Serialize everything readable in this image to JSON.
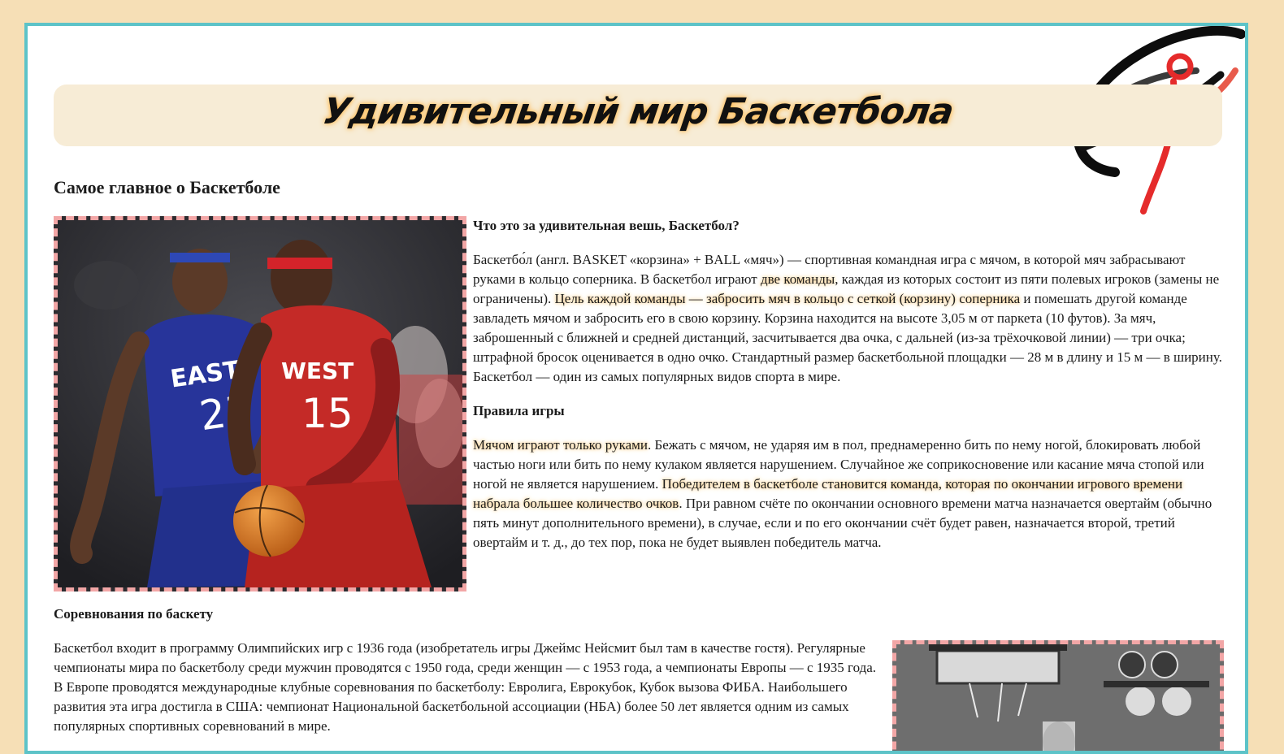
{
  "header": {
    "title": "Удивительный мир Баскетбола"
  },
  "main": {
    "section_title": "Самое главное о Баскетболе",
    "what_is": {
      "heading": "Что это за удивительная вешь, Баскетбол?",
      "paragraph_parts": [
        "Баскетбо́л (англ. BASKET «корзина» + BALL «мяч») — спортивная командная игра с мячом, в которой мяч забрасывают руками в кольцо соперника. В баскетбол играют ",
        "две команды",
        ", каждая из которых состоит из пяти полевых игроков (замены не ограничены). ",
        "Цель каждой команды — забросить мяч в кольцо с сеткой (корзину) соперника",
        " и помешать другой команде завладеть мячом и забросить его в свою корзину. Корзина находится на высоте 3,05 м от паркета (10 футов). За мяч, заброшенный с ближней и средней дистанций, засчитывается два очка, с дальней (из-за трёхочковой линии) — три очка; штрафной бросок оценивается в одно очко. Стандартный размер баскетбольной площадки — 28 м в длину и 15 м — в ширину. Баскетбол — один из самых популярных видов спорта в мире."
      ]
    },
    "rules": {
      "heading": "Правила игры",
      "paragraph_parts": [
        "Мячом играют только руками",
        ". Бежать с мячом, не ударяя им в пол, преднамеренно бить по нему ногой, блокировать любой частью ноги или бить по нему кулаком является нарушением. Случайное же соприкосновение или касание мяча стопой или ногой не является нарушением. ",
        "Победителем в баскетболе становится команда, которая по окончании игрового времени набрала большее количество очков",
        ". При равном счёте по окончании основного времени матча назначается овертайм (обычно пять минут дополнительного времени), в случае, если и по его окончании счёт будет равен, назначается второй, третий овертайм и т. д., до тех пор, пока не будет выявлен победитель матча."
      ]
    },
    "competitions": {
      "heading": "Соревнования по баскету",
      "paragraph": "Баскетбол входит в программу Олимпийских игр с 1936 года (изобретатель игры Джеймс Нейсмит был там в качестве гостя). Регулярные чемпионаты мира по баскетболу среди мужчин проводятся с 1950 года, среди женщин — с 1953 года, а чемпионаты Европы — с 1935 года. В Европе проводятся международные клубные соревнования по баскетболу: Евролига, Еврокубок, Кубок вызова ФИБА. Наибольшего развития эта игра достигла в США: чемпионат Национальной баскетбольной ассоциации (НБА) более 50 лет является одним из самых популярных спортивных соревнований в мире."
    }
  },
  "images": {
    "photo_1": {
      "jersey_left_text": "EAST",
      "jersey_left_number": "23",
      "jersey_right_text": "WEST",
      "jersey_right_number": "15"
    }
  },
  "colors": {
    "background": "#f6dfb6",
    "border": "#5dc3c8",
    "banner": "#f7ecd6",
    "photo_frame": "#f2a6a6",
    "highlight_glow": "#f7c67a",
    "jersey_red": "#c42a27",
    "jersey_blue": "#27349a"
  },
  "icons": {
    "logo": "basketball-player-logo-icon"
  }
}
